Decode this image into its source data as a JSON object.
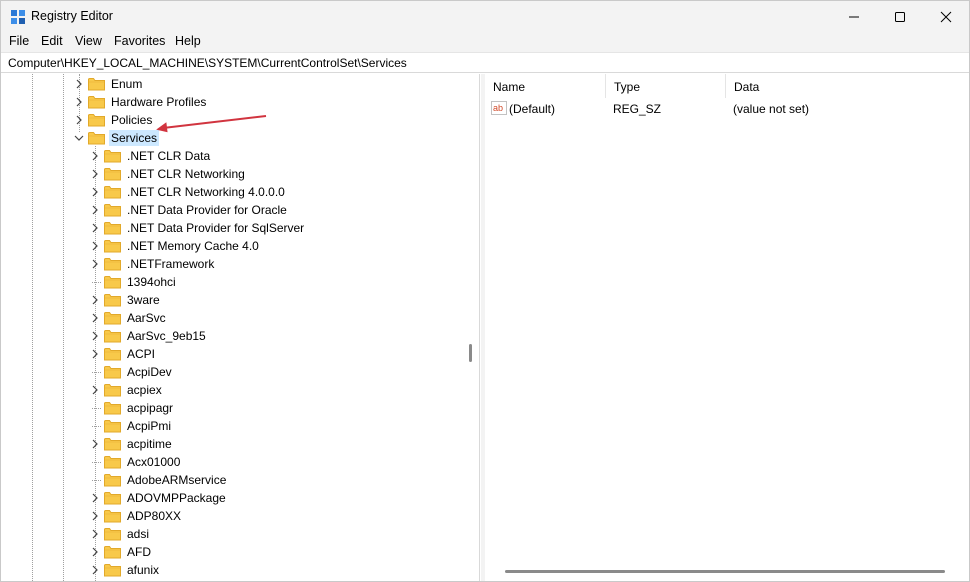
{
  "window": {
    "title": "Registry Editor",
    "controls": {
      "minimize": "minimize",
      "maximize": "maximize",
      "close": "close"
    }
  },
  "menu": [
    "File",
    "Edit",
    "View",
    "Favorites",
    "Help"
  ],
  "address": "Computer\\HKEY_LOCAL_MACHINE\\SYSTEM\\CurrentControlSet\\Services",
  "tree": {
    "parents": [
      {
        "label": "Enum",
        "expandable": true
      },
      {
        "label": "Hardware Profiles",
        "expandable": true
      },
      {
        "label": "Policies",
        "expandable": true
      },
      {
        "label": "Services",
        "expandable": true,
        "expanded": true,
        "selected": true
      }
    ],
    "children": [
      {
        "label": ".NET CLR Data",
        "expandable": true
      },
      {
        "label": ".NET CLR Networking",
        "expandable": true
      },
      {
        "label": ".NET CLR Networking 4.0.0.0",
        "expandable": true
      },
      {
        "label": ".NET Data Provider for Oracle",
        "expandable": true
      },
      {
        "label": ".NET Data Provider for SqlServer",
        "expandable": true
      },
      {
        "label": ".NET Memory Cache 4.0",
        "expandable": true
      },
      {
        "label": ".NETFramework",
        "expandable": true
      },
      {
        "label": "1394ohci",
        "expandable": false
      },
      {
        "label": "3ware",
        "expandable": true
      },
      {
        "label": "AarSvc",
        "expandable": true
      },
      {
        "label": "AarSvc_9eb15",
        "expandable": true
      },
      {
        "label": "ACPI",
        "expandable": true
      },
      {
        "label": "AcpiDev",
        "expandable": false
      },
      {
        "label": "acpiex",
        "expandable": true
      },
      {
        "label": "acpipagr",
        "expandable": false
      },
      {
        "label": "AcpiPmi",
        "expandable": false
      },
      {
        "label": "acpitime",
        "expandable": true
      },
      {
        "label": "Acx01000",
        "expandable": false
      },
      {
        "label": "AdobeARMservice",
        "expandable": false
      },
      {
        "label": "ADOVMPPackage",
        "expandable": true
      },
      {
        "label": "ADP80XX",
        "expandable": true
      },
      {
        "label": "adsi",
        "expandable": true
      },
      {
        "label": "AFD",
        "expandable": true
      },
      {
        "label": "afunix",
        "expandable": true
      }
    ]
  },
  "list": {
    "columns": [
      "Name",
      "Type",
      "Data"
    ],
    "rows": [
      {
        "name": "(Default)",
        "type": "REG_SZ",
        "data": "(value not set)"
      }
    ]
  },
  "colors": {
    "folder": "#f8c94a",
    "folder_dark": "#e2a92a",
    "selection": "#cce8ff",
    "arrow": "#d1343f"
  }
}
